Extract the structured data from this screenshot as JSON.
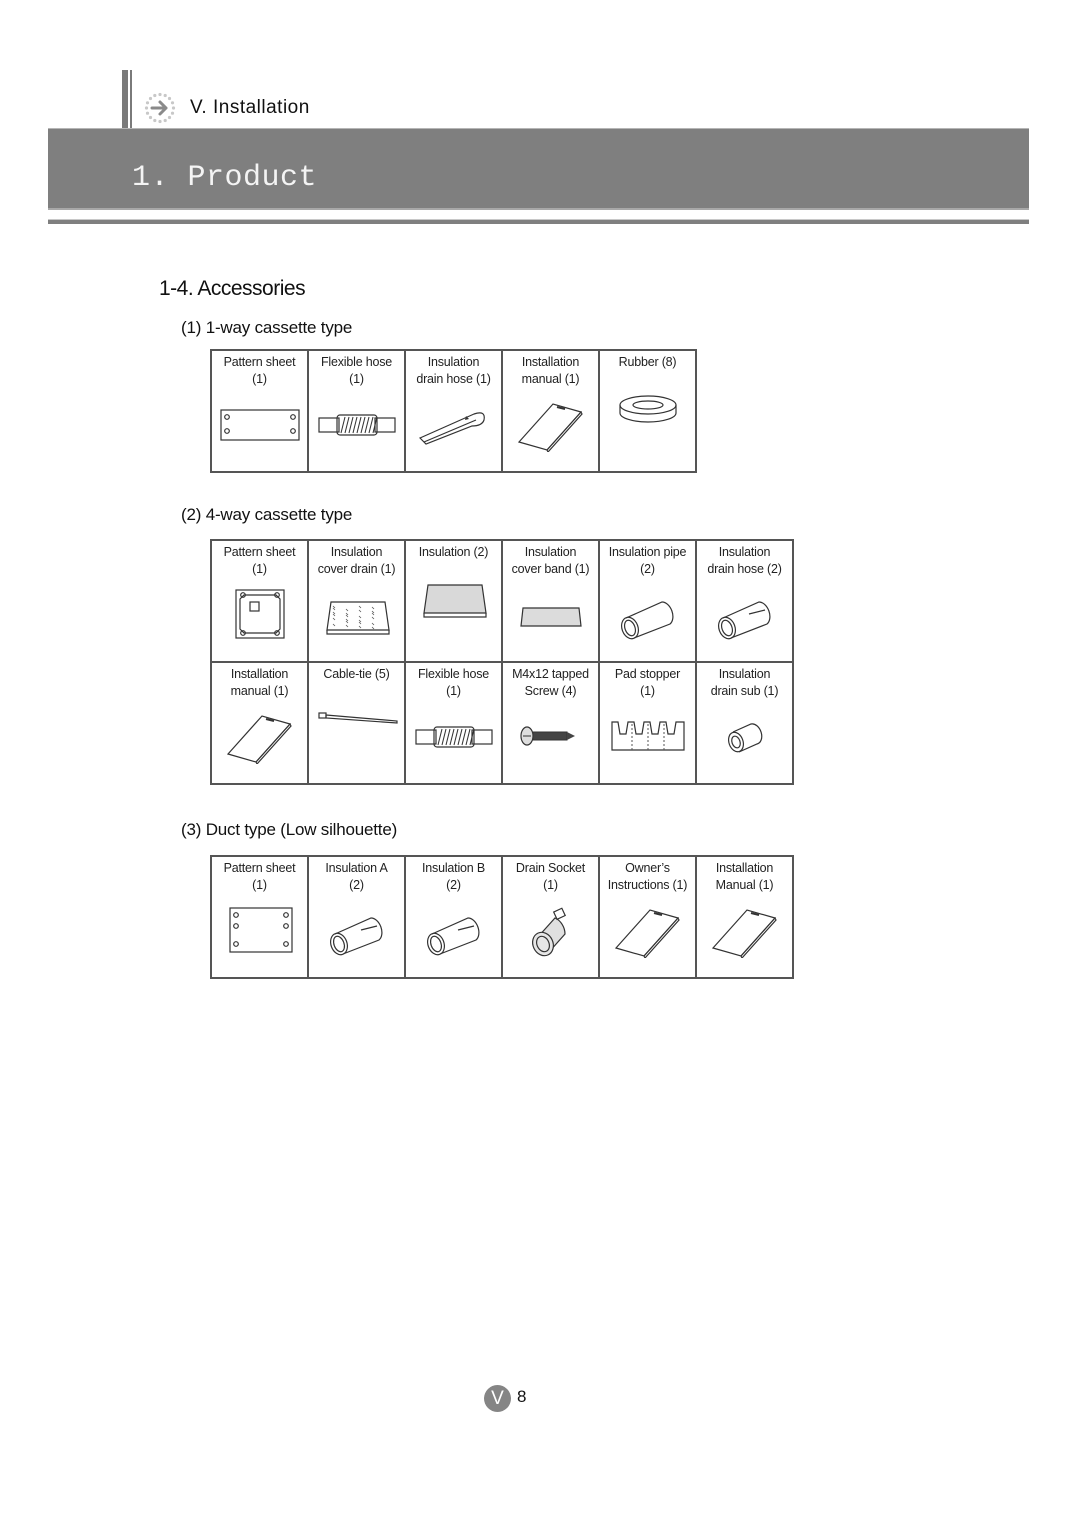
{
  "header": {
    "chapter_label": "V. Installation",
    "chapter_icon": "arrow-right-circle-icon",
    "banner_title": "1. Product"
  },
  "section": {
    "title": "1-4. Accessories"
  },
  "groups": [
    {
      "title": "(1) 1-way cassette type",
      "rows": [
        [
          {
            "label": "Pattern sheet\n(1)",
            "icon": "pattern-sheet-4-holes"
          },
          {
            "label": "Flexible hose\n(1)",
            "icon": "flexible-hose"
          },
          {
            "label": "Insulation\ndrain hose (1)",
            "icon": "insulation-drain-hose-clip"
          },
          {
            "label": "Installation\nmanual (1)",
            "icon": "manual-booklet"
          },
          {
            "label": "Rubber (8)",
            "icon": "rubber-ring"
          }
        ]
      ]
    },
    {
      "title": "(2) 4-way cassette type",
      "rows": [
        [
          {
            "label": "Pattern sheet\n(1)",
            "icon": "pattern-sheet-square"
          },
          {
            "label": "Insulation\ncover drain (1)",
            "icon": "insulation-pad-speckled"
          },
          {
            "label": "Insulation (2)",
            "icon": "insulation-pad-dotted"
          },
          {
            "label": "Insulation\ncover band (1)",
            "icon": "insulation-band"
          },
          {
            "label": "Insulation pipe\n(2)",
            "icon": "insulation-pipe"
          },
          {
            "label": "Insulation\ndrain hose (2)",
            "icon": "insulation-tube-slit"
          }
        ],
        [
          {
            "label": "Installation\nmanual (1)",
            "icon": "manual-booklet"
          },
          {
            "label": "Cable-tie (5)",
            "icon": "cable-tie"
          },
          {
            "label": "Flexible hose\n(1)",
            "icon": "flexible-hose"
          },
          {
            "label": "M4x12 tapped\nScrew (4)",
            "icon": "tapped-screw"
          },
          {
            "label": "Pad stopper\n(1)",
            "icon": "pad-stopper"
          },
          {
            "label": "Insulation\ndrain sub (1)",
            "icon": "short-tube"
          }
        ]
      ]
    },
    {
      "title": "(3) Duct type (Low silhouette)",
      "rows": [
        [
          {
            "label": "Pattern sheet\n(1)",
            "icon": "pattern-sheet-6-holes"
          },
          {
            "label": "Insulation A\n(2)",
            "icon": "insulation-tube-slit"
          },
          {
            "label": "Insulation B\n(2)",
            "icon": "insulation-tube-slit"
          },
          {
            "label": "Drain Socket\n(1)",
            "icon": "drain-socket"
          },
          {
            "label": "Owner’s\nInstructions (1)",
            "icon": "manual-booklet"
          },
          {
            "label": "Installation\nManual (1)",
            "icon": "manual-booklet"
          }
        ]
      ]
    }
  ],
  "footer": {
    "chapter_badge": "V",
    "page_number": "8"
  }
}
